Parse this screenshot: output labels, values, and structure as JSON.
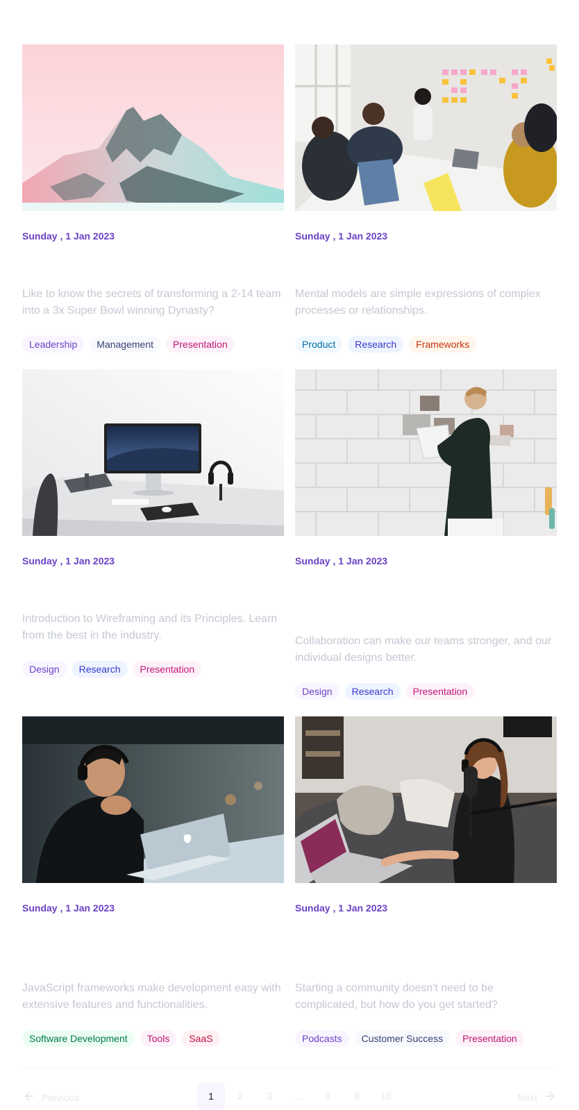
{
  "posts": [
    {
      "date": "Sunday , 1 Jan 2023",
      "description": "Like to know the secrets of transforming a 2-14 team into a 3x Super Bowl winning Dynasty?",
      "image": "snowy mountain peak against pink sky",
      "tags": [
        "Leadership",
        "Management",
        "Presentation"
      ]
    },
    {
      "date": "Sunday , 1 Jan 2023",
      "description": "Mental models are simple expressions of complex processes or relationships.",
      "image": "team meeting around table with sticky notes on wall",
      "tags": [
        "Product",
        "Research",
        "Frameworks"
      ]
    },
    {
      "date": "Sunday , 1 Jan 2023",
      "description": "Introduction to Wireframing and its Principles. Learn from the best in the industry.",
      "image": "desk with monitor, laptop and headphones",
      "tags": [
        "Design",
        "Research",
        "Presentation"
      ]
    },
    {
      "date": "Sunday , 1 Jan 2023",
      "description": "Collaboration can make our teams stronger, and our individual designs better.",
      "image": "man pinning photos on white brick wall",
      "tags": [
        "Design",
        "Research",
        "Presentation"
      ]
    },
    {
      "date": "Sunday , 1 Jan 2023",
      "description": "JavaScript frameworks make development easy with extensive features and functionalities.",
      "image": "man with headphones looking at laptop",
      "tags": [
        "Software Development",
        "Tools",
        "SaaS"
      ]
    },
    {
      "date": "Sunday , 1 Jan 2023",
      "description": "Starting a community doesn't need to be complicated, but how do you get started?",
      "image": "woman recording podcast on sofa with laptop",
      "tags": [
        "Podcasts",
        "Customer Success",
        "Presentation"
      ]
    }
  ],
  "pagination": {
    "previous_label": "Previous",
    "next_label": "Next",
    "pages": [
      "1",
      "2",
      "3",
      "...",
      "8",
      "9",
      "10"
    ],
    "current_page": "1",
    "previous_icon": "arrow-left-icon",
    "next_icon": "arrow-right-icon"
  },
  "colors": {
    "accent": "#6941c6",
    "description_text": "#c4c8d2",
    "divider": "#f2f4f7"
  }
}
